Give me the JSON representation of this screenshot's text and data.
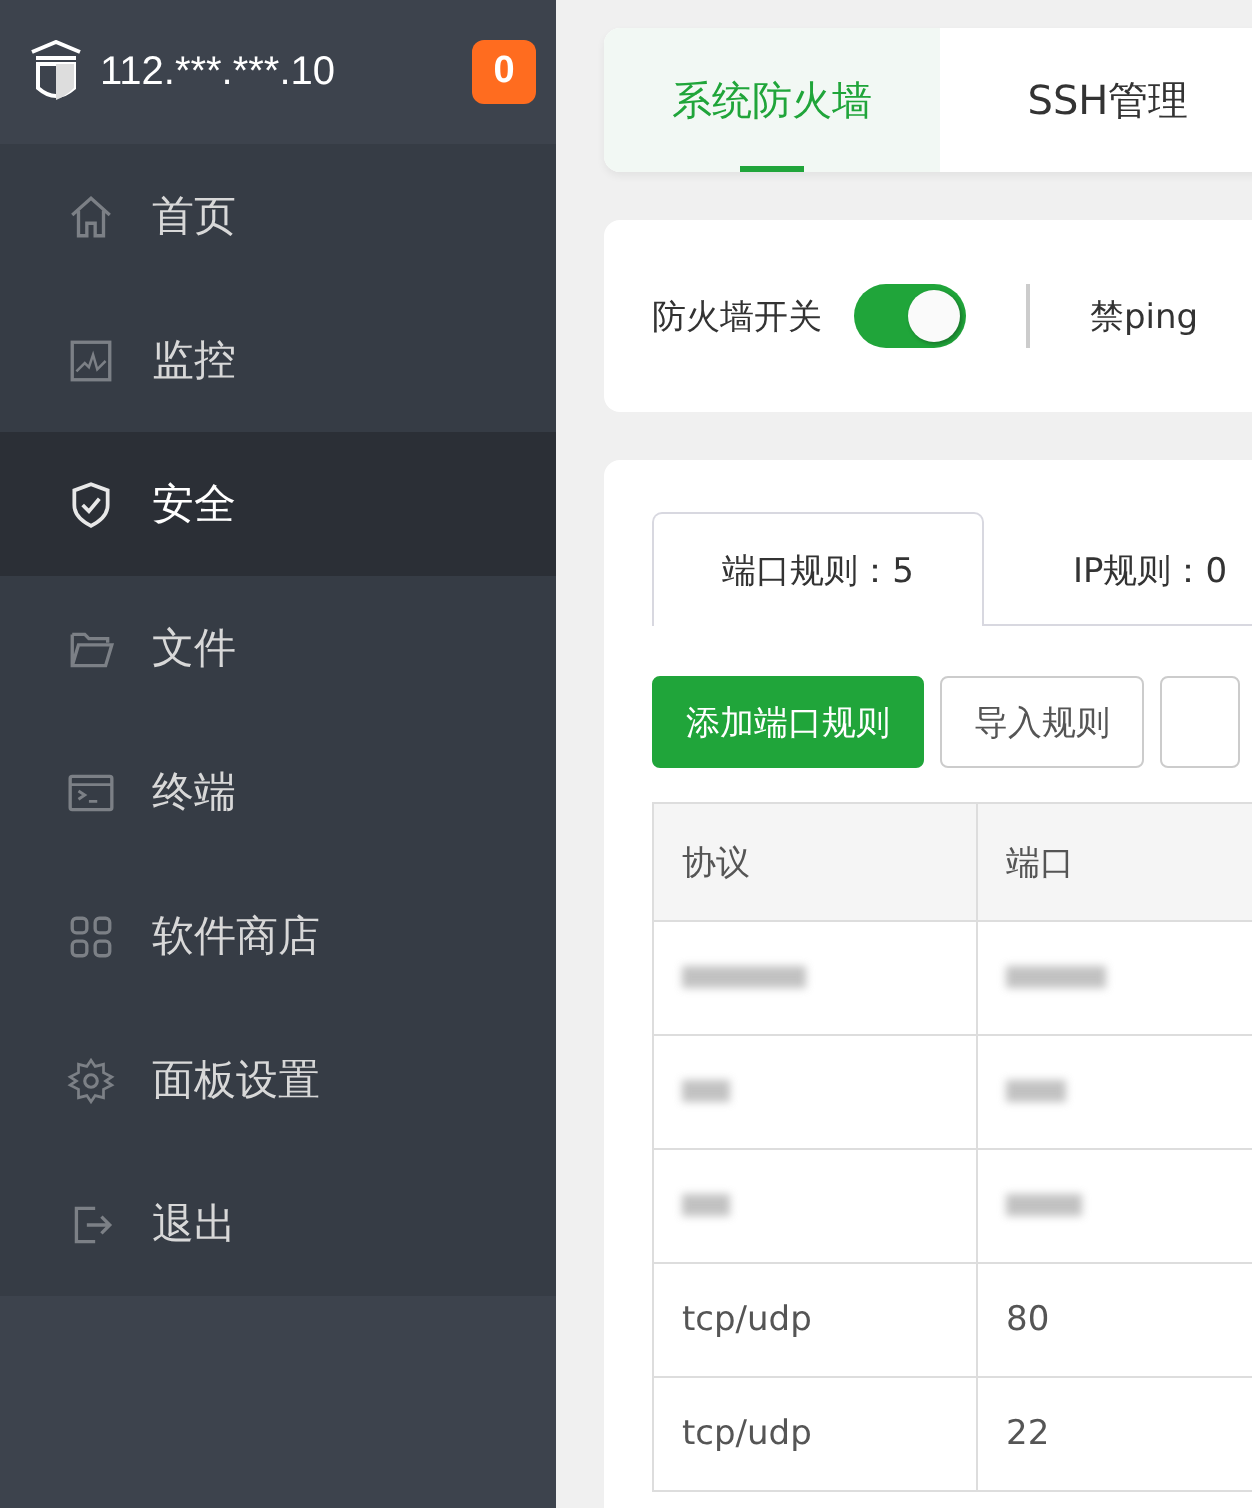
{
  "sidebar": {
    "title": "112.***.***.10",
    "badge": "0",
    "items": [
      {
        "label": "首页",
        "selected": false
      },
      {
        "label": "监控",
        "selected": false
      },
      {
        "label": "安全",
        "selected": true
      },
      {
        "label": "文件",
        "selected": false
      },
      {
        "label": "终端",
        "selected": false
      },
      {
        "label": "软件商店",
        "selected": false
      },
      {
        "label": "面板设置",
        "selected": false
      },
      {
        "label": "退出",
        "selected": false
      }
    ]
  },
  "tabs": [
    {
      "label": "系统防火墙",
      "selected": true
    },
    {
      "label": "SSH管理",
      "selected": false
    }
  ],
  "switches": [
    {
      "label": "防火墙开关",
      "on": true
    },
    {
      "label": "禁ping"
    }
  ],
  "rule_tabs": [
    {
      "label": "端口规则：5",
      "selected": true
    },
    {
      "label": "IP规则：0",
      "selected": false
    }
  ],
  "buttons": [
    {
      "label": "添加端口规则",
      "kind": "primary"
    },
    {
      "label": "导入规则",
      "kind": "default"
    },
    {
      "kind": "default"
    }
  ],
  "table": {
    "columns": [
      "协议",
      "端口"
    ],
    "rows": [
      {
        "redacted": true
      },
      {
        "redacted": true
      },
      {
        "redacted": true
      },
      {
        "cells": [
          "tcp/udp",
          "80"
        ]
      },
      {
        "cells": [
          "tcp/udp",
          "22"
        ]
      }
    ]
  }
}
